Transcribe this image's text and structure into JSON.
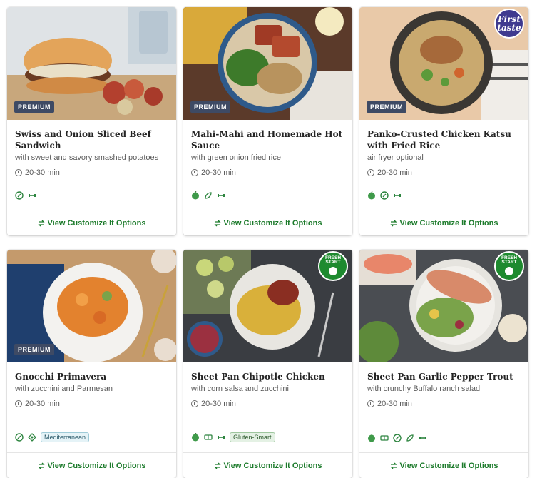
{
  "colors": {
    "accent_green": "#1b7a2a",
    "premium_badge": "#3e4a64",
    "first_taste_badge": "#3f3a8f",
    "fresh_start_badge": "#1e8a2f"
  },
  "cards": [
    {
      "title": "Swiss and Onion Sliced Beef Sandwich",
      "subtitle": "with sweet and savory smashed potatoes",
      "time": "20-30 min",
      "badge": "PREMIUM",
      "tag_icons": [
        "carb-smart-icon",
        "protein-icon"
      ],
      "pill": "",
      "cta": "View Customize It Options"
    },
    {
      "title": "Mahi-Mahi and Homemade Hot Sauce",
      "subtitle": "with green onion fried rice",
      "time": "20-30 min",
      "badge": "PREMIUM",
      "tag_icons": [
        "calorie-smart-icon",
        "fiber-icon",
        "protein-icon"
      ],
      "pill": "",
      "cta": "View Customize It Options"
    },
    {
      "title": "Panko-Crusted Chicken Katsu with Fried Rice",
      "subtitle": "air fryer optional",
      "time": "20-30 min",
      "badge": "PREMIUM",
      "sticker": "First taste",
      "tag_icons": [
        "calorie-smart-icon",
        "carb-smart-icon",
        "protein-icon"
      ],
      "pill": "",
      "cta": "View Customize It Options"
    },
    {
      "title": "Gnocchi Primavera",
      "subtitle": "with zucchini and Parmesan",
      "time": "20-30 min",
      "badge": "PREMIUM",
      "tag_icons": [
        "carb-smart-icon",
        "veggie-icon"
      ],
      "pill": "Mediterranean",
      "cta": "View Customize It Options"
    },
    {
      "title": "Sheet Pan Chipotle Chicken",
      "subtitle": "with corn salsa and zucchini",
      "time": "20-30 min",
      "badge": "",
      "sticker": "FRESH START",
      "tag_icons": [
        "calorie-smart-icon",
        "sheet-pan-icon",
        "protein-icon"
      ],
      "pill": "Gluten-Smart",
      "cta": "View Customize It Options"
    },
    {
      "title": "Sheet Pan Garlic Pepper Trout",
      "subtitle": "with crunchy Buffalo ranch salad",
      "time": "20-30 min",
      "badge": "",
      "sticker": "FRESH START",
      "tag_icons": [
        "calorie-smart-icon",
        "sheet-pan-icon",
        "carb-smart-icon",
        "fiber-icon",
        "protein-icon"
      ],
      "pill": "",
      "cta": "View Customize It Options"
    }
  ]
}
